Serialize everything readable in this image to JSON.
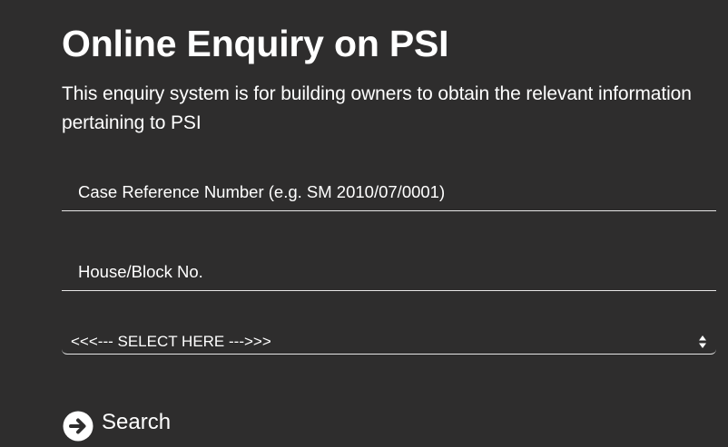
{
  "header": {
    "title": "Online Enquiry on PSI",
    "description": "This enquiry system is for building owners to obtain the relevant information pertaining to PSI"
  },
  "form": {
    "case_reference": {
      "placeholder": "Case Reference Number (e.g. SM 2010/07/0001)",
      "value": ""
    },
    "house_block": {
      "placeholder": "House/Block No.",
      "value": ""
    },
    "select": {
      "selected": "<<<--- SELECT HERE --->>>",
      "icon": "updown-arrows-icon"
    },
    "search_button": {
      "label": "Search",
      "icon": "arrow-right-circle-icon"
    }
  },
  "colors": {
    "background": "#2e2d2d",
    "text": "#ffffff",
    "underline": "#e6e6e6"
  }
}
